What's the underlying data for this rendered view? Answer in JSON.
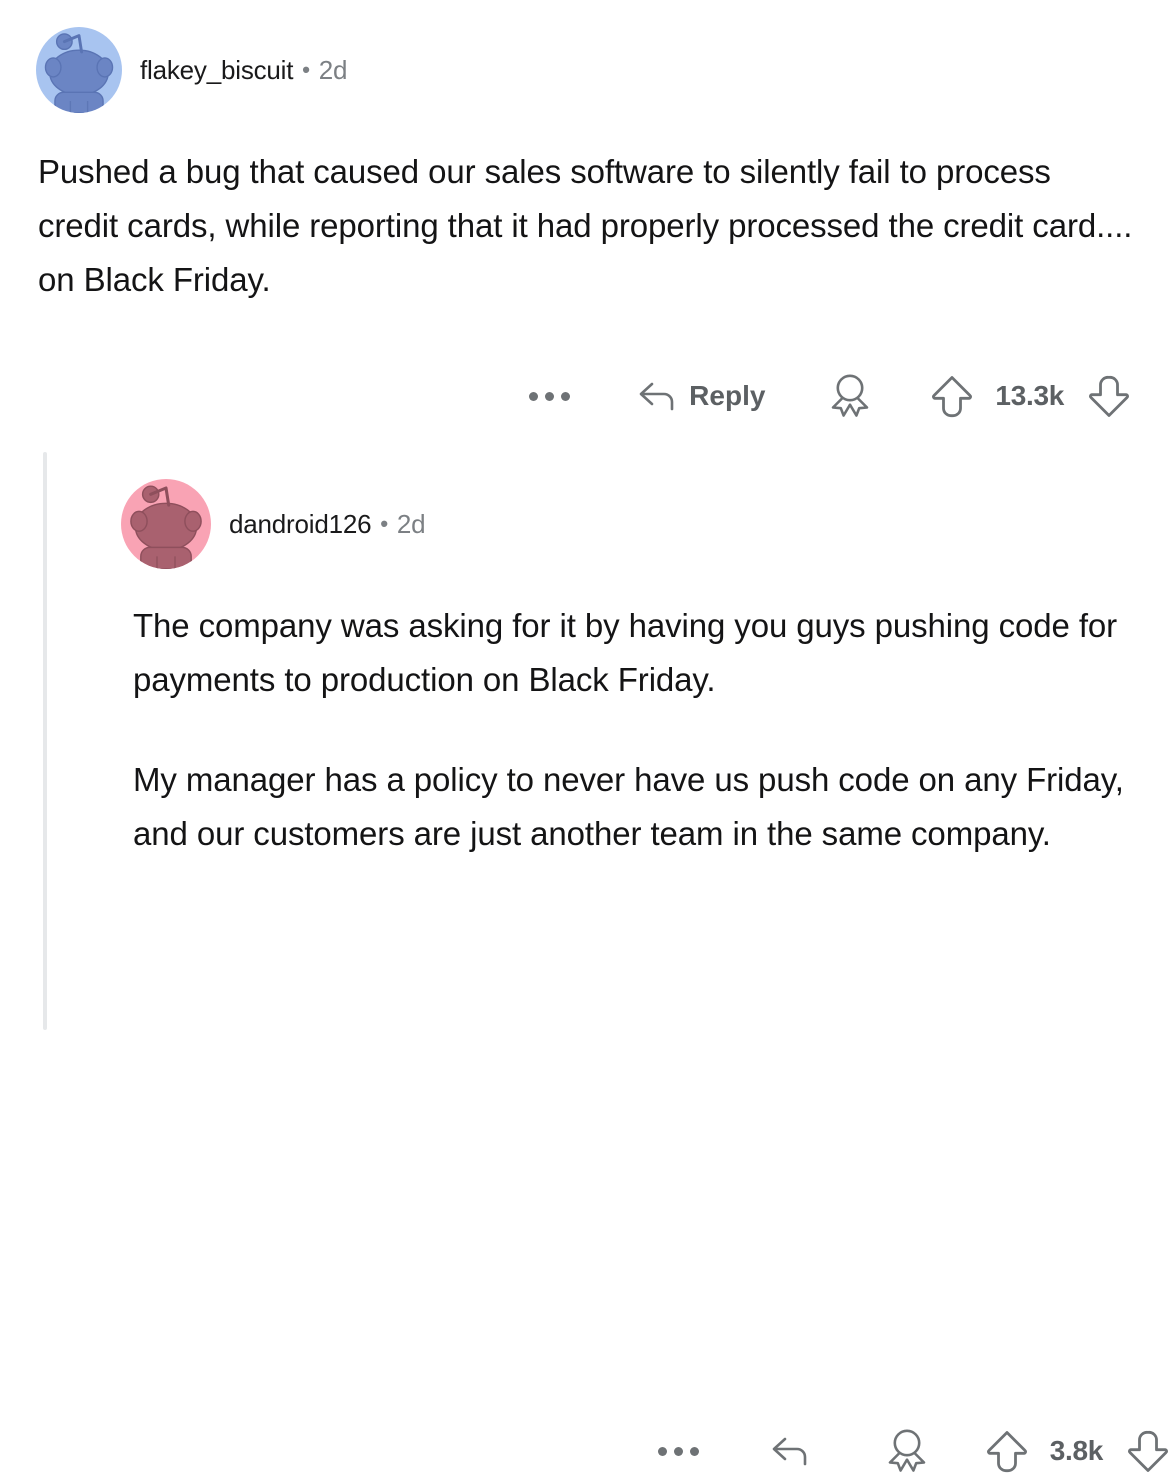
{
  "thread": {
    "line_color": "#e6e8ea"
  },
  "comments": [
    {
      "id": "root-comment",
      "author": "flakey_biscuit",
      "separator": "•",
      "timestamp": "2d",
      "avatar": {
        "icon": "reddit-snoo-avatar",
        "background_color": "#a8c4f0",
        "figure_color": "#6b85c4"
      },
      "paragraphs": [
        "Pushed a bug that caused our sales software to silently fail to process credit cards, while reporting that it had properly processed the credit card.... on Black Friday."
      ],
      "actions": {
        "more_label": "more options",
        "more_icon": "ellipsis-icon",
        "reply_label": "Reply",
        "reply_icon": "reply-arrow-icon",
        "award_label": "Give award",
        "award_icon": "award-ribbon-icon",
        "upvote_icon": "upvote-arrow-icon",
        "downvote_icon": "downvote-arrow-icon",
        "vote_count": "13.3k"
      }
    },
    {
      "id": "nested-reply",
      "author": "dandroid126",
      "separator": "•",
      "timestamp": "2d",
      "avatar": {
        "icon": "reddit-snoo-avatar",
        "background_color": "#f9a3b4",
        "figure_color": "#a9616f"
      },
      "paragraphs": [
        "The company was asking for it by having you guys pushing code for payments to production on Black Friday.",
        "My manager has a policy to never have us push code on any Friday, and our customers are just another team in the same company."
      ],
      "actions": {
        "more_label": "more options",
        "more_icon": "ellipsis-icon",
        "reply_label": "",
        "reply_icon": "reply-arrow-icon",
        "award_label": "Give award",
        "award_icon": "award-ribbon-icon",
        "upvote_icon": "upvote-arrow-icon",
        "downvote_icon": "downvote-arrow-icon",
        "vote_count": "3.8k"
      }
    }
  ]
}
